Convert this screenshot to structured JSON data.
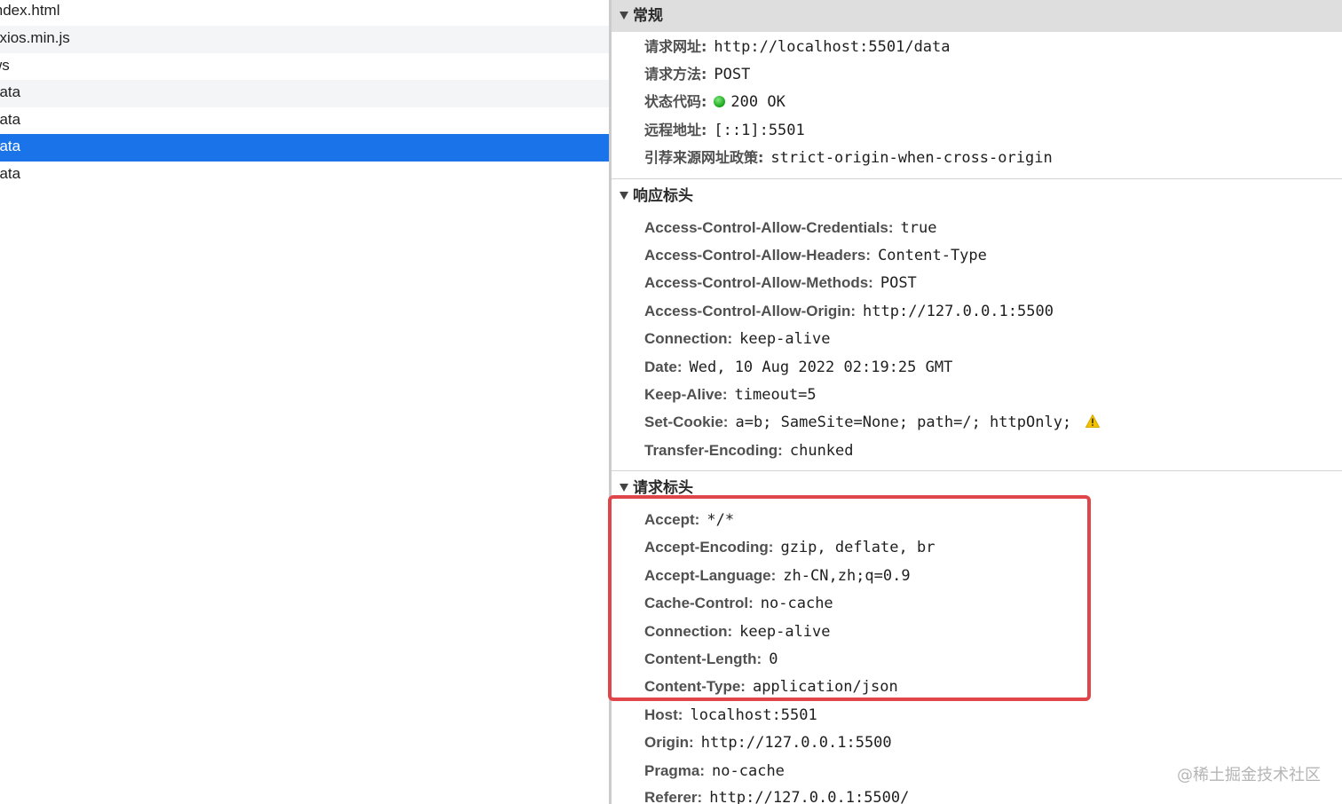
{
  "request_list": [
    {
      "name": "index.html",
      "selected": false
    },
    {
      "name": "axios.min.js",
      "selected": false
    },
    {
      "name": "ws",
      "selected": false
    },
    {
      "name": "data",
      "selected": false
    },
    {
      "name": "data",
      "selected": false
    },
    {
      "name": "data",
      "selected": true
    },
    {
      "name": "data",
      "selected": false
    }
  ],
  "general": {
    "title": "常规",
    "rows": [
      {
        "key": "请求网址:",
        "value": "http://localhost:5501/data"
      },
      {
        "key": "请求方法:",
        "value": "POST"
      },
      {
        "key": "状态代码:",
        "value": "200 OK",
        "status_color": "#1fb41f"
      },
      {
        "key": "远程地址:",
        "value": "[::1]:5501"
      },
      {
        "key": "引荐来源网址政策:",
        "value": "strict-origin-when-cross-origin"
      }
    ]
  },
  "response_headers": {
    "title": "响应标头",
    "rows": [
      {
        "key": "Access-Control-Allow-Credentials:",
        "value": "true"
      },
      {
        "key": "Access-Control-Allow-Headers:",
        "value": "Content-Type"
      },
      {
        "key": "Access-Control-Allow-Methods:",
        "value": "POST"
      },
      {
        "key": "Access-Control-Allow-Origin:",
        "value": "http://127.0.0.1:5500"
      },
      {
        "key": "Connection:",
        "value": "keep-alive"
      },
      {
        "key": "Date:",
        "value": "Wed, 10 Aug 2022 02:19:25 GMT"
      },
      {
        "key": "Keep-Alive:",
        "value": "timeout=5"
      },
      {
        "key": "Set-Cookie:",
        "value": "a=b; SameSite=None; path=/; httpOnly;",
        "icon": "warning-icon"
      },
      {
        "key": "Transfer-Encoding:",
        "value": "chunked"
      }
    ]
  },
  "request_headers": {
    "title": "请求标头",
    "rows": [
      {
        "key": "Accept:",
        "value": "*/*"
      },
      {
        "key": "Accept-Encoding:",
        "value": "gzip, deflate, br"
      },
      {
        "key": "Accept-Language:",
        "value": "zh-CN,zh;q=0.9"
      },
      {
        "key": "Cache-Control:",
        "value": "no-cache"
      },
      {
        "key": "Connection:",
        "value": "keep-alive"
      },
      {
        "key": "Content-Length:",
        "value": "0"
      },
      {
        "key": "Content-Type:",
        "value": "application/json"
      },
      {
        "key": "Host:",
        "value": "localhost:5501"
      },
      {
        "key": "Origin:",
        "value": "http://127.0.0.1:5500"
      },
      {
        "key": "Pragma:",
        "value": "no-cache"
      },
      {
        "key": "Referer:",
        "value": "http://127.0.0.1:5500/"
      }
    ]
  },
  "annotation": {
    "highlight_color": "#e0454a"
  },
  "watermark": "@稀土掘金技术社区",
  "colors": {
    "selection": "#1a73e8",
    "section_header_bg": "#dedede",
    "warning": "#f2c200"
  }
}
